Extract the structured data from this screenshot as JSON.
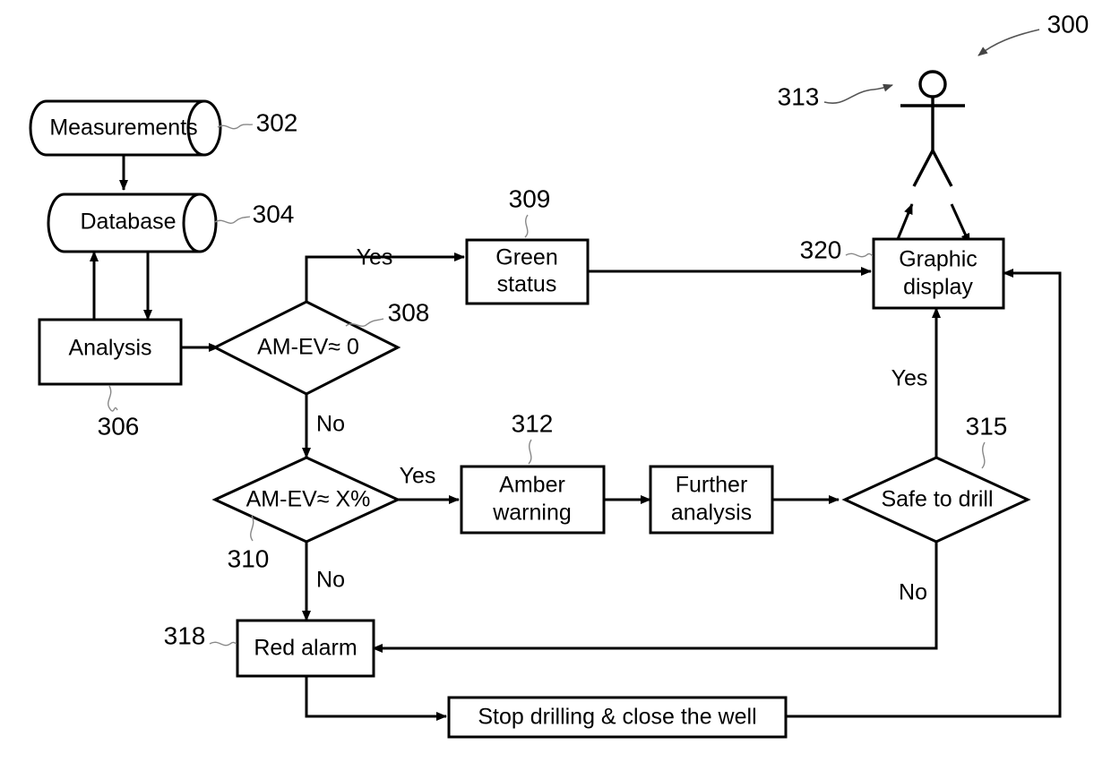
{
  "figure": {
    "title": "Drilling measurement evaluation flowchart",
    "overall_reference": "300",
    "stroke_color": "#000000",
    "background_color": "#ffffff",
    "leader_color": "#888888"
  },
  "nodes": {
    "measurements": {
      "label": "Measurements",
      "ref": "302",
      "shape": "cylinder"
    },
    "database": {
      "label": "Database",
      "ref": "304",
      "shape": "cylinder"
    },
    "analysis": {
      "label": "Analysis",
      "ref": "306",
      "shape": "process"
    },
    "decision_zero": {
      "label": "AM-EV≈ 0",
      "ref": "308",
      "shape": "decision"
    },
    "green_status": {
      "label_line1": "Green",
      "label_line2": "status",
      "ref": "309",
      "shape": "process"
    },
    "decision_percent": {
      "label": "AM-EV≈ X%",
      "ref": "310",
      "shape": "decision"
    },
    "amber_warning": {
      "label_line1": "Amber",
      "label_line2": "warning",
      "ref": "312",
      "shape": "process"
    },
    "further_analysis": {
      "label_line1": "Further",
      "label_line2": "analysis",
      "ref": "",
      "shape": "process"
    },
    "safe_to_drill": {
      "label": "Safe to drill",
      "ref": "315",
      "shape": "decision"
    },
    "red_alarm": {
      "label": "Red alarm",
      "ref": "318",
      "shape": "process"
    },
    "stop_drilling": {
      "label": "Stop drilling & close the well",
      "ref": "",
      "shape": "process"
    },
    "graphic_display": {
      "label_line1": "Graphic",
      "label_line2": "display",
      "ref": "320",
      "shape": "process"
    },
    "operator": {
      "label": "",
      "ref": "313",
      "shape": "stick-figure"
    }
  },
  "edge_labels": {
    "zero_yes": "Yes",
    "zero_no": "No",
    "percent_yes": "Yes",
    "percent_no": "No",
    "safe_yes": "Yes",
    "safe_no": "No"
  },
  "references": {
    "r300": "300",
    "r302": "302",
    "r304": "304",
    "r306": "306",
    "r308": "308",
    "r309": "309",
    "r310": "310",
    "r312": "312",
    "r313": "313",
    "r315": "315",
    "r318": "318",
    "r320": "320"
  }
}
